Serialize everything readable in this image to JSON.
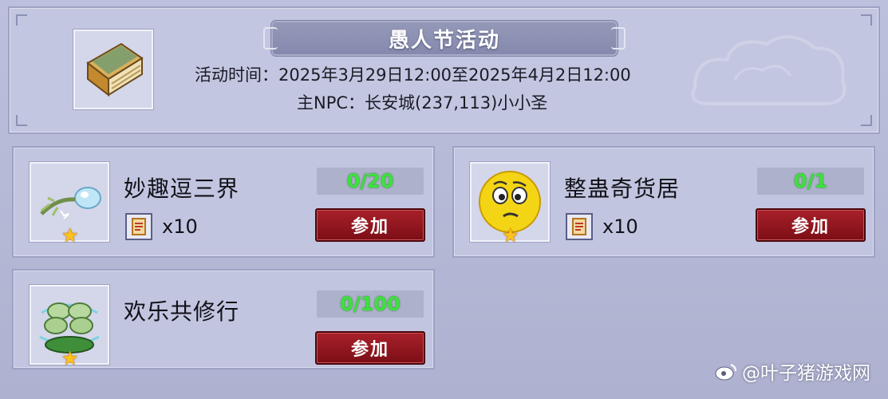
{
  "header": {
    "title": "愚人节活动",
    "time_line": "活动时间：2025年3月29日12:00至2025年4月2日12:00",
    "npc_line": "主NPC：长安城(237,113)小小圣",
    "icon": "book-icon"
  },
  "activities": [
    {
      "name": "妙趣逗三界",
      "progress": "0/20",
      "reward_qty": "x10",
      "button_label": "参加",
      "icon": "feather-orb-icon"
    },
    {
      "name": "整蛊奇货居",
      "progress": "0/1",
      "reward_qty": "x10",
      "button_label": "参加",
      "icon": "confused-face-icon"
    },
    {
      "name": "欢乐共修行",
      "progress": "0/100",
      "button_label": "参加",
      "icon": "clover-icon"
    }
  ],
  "watermark": "@叶子猪游戏网",
  "colors": {
    "progress_text": "#3de13d",
    "button_bg": "#9a1820",
    "star": "#ffc21a"
  }
}
